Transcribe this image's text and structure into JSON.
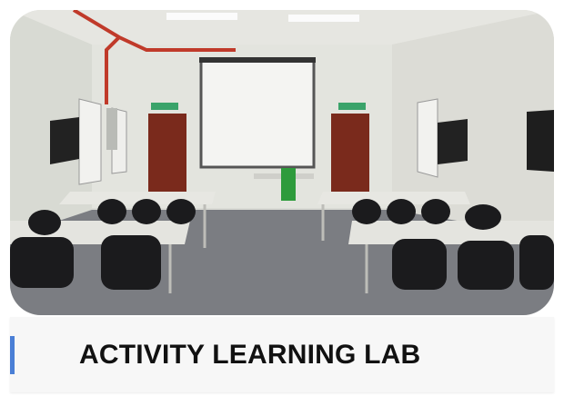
{
  "card": {
    "title": "ACTIVITY LEARNING LAB",
    "accent_color": "#4a7fd6",
    "photo_subject": "classroom-photo"
  }
}
